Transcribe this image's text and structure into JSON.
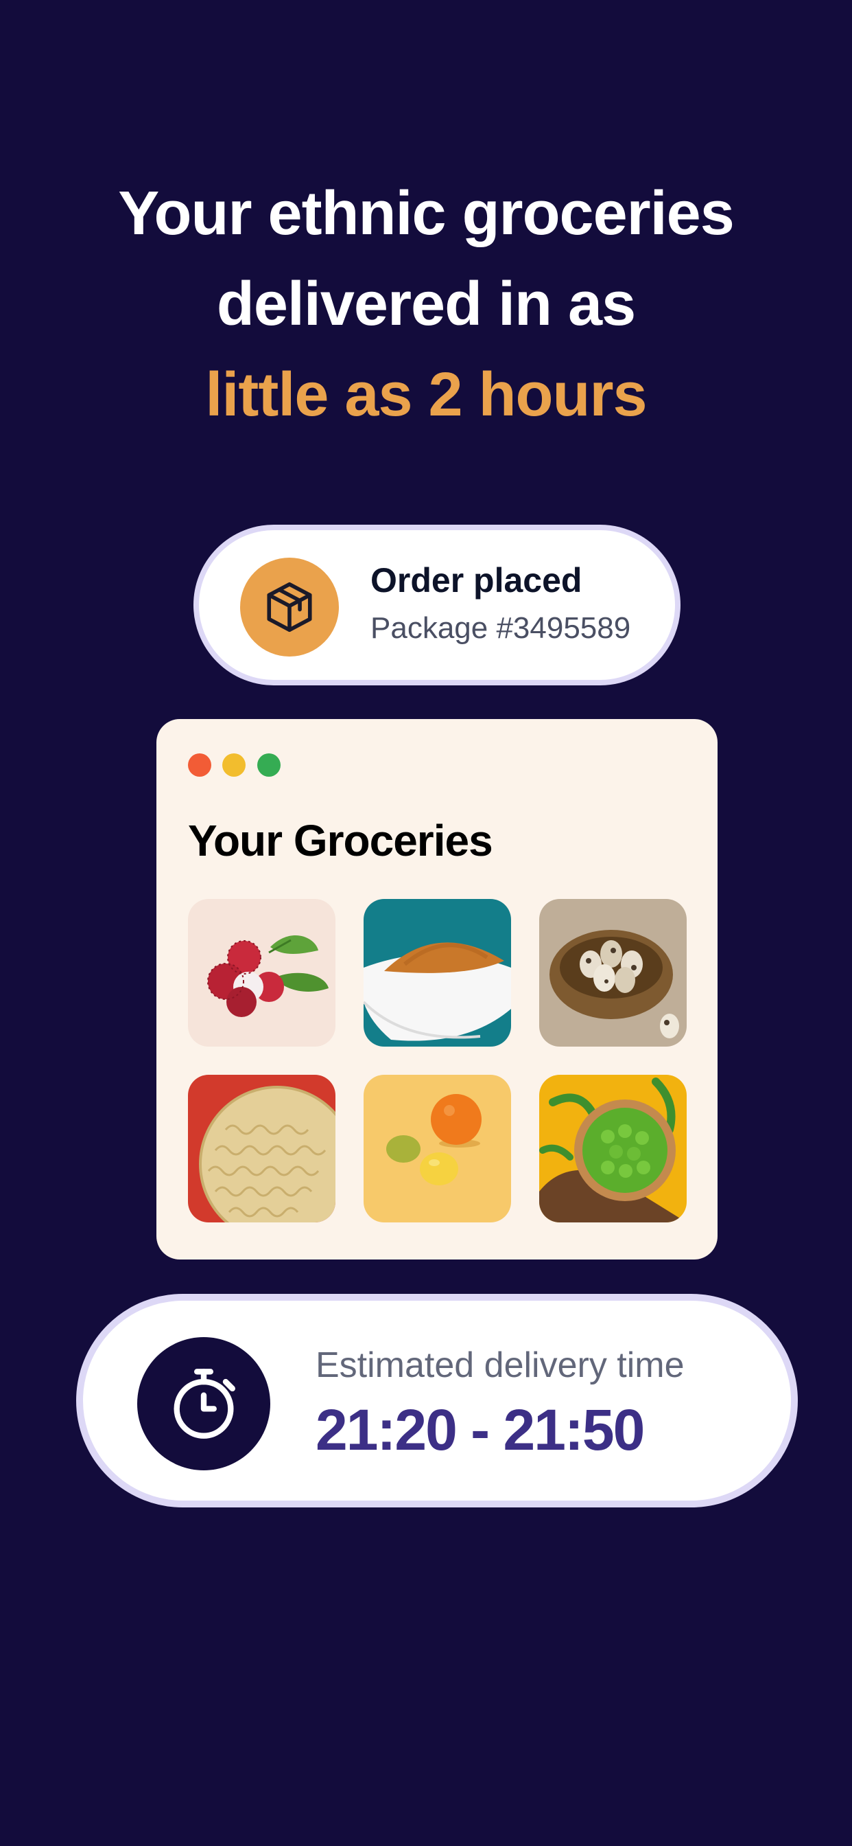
{
  "headline": {
    "line1": "Your ethnic groceries",
    "line2": "delivered in as",
    "line3": "little as 2 hours"
  },
  "order": {
    "title": "Order placed",
    "subtitle": "Package #3495589",
    "icon": "package-box-icon"
  },
  "groceries": {
    "title": "Your Groceries",
    "window_dots": [
      "#f25c36",
      "#f2bd2e",
      "#35ac53"
    ],
    "items": [
      {
        "name": "lychee"
      },
      {
        "name": "ground-spice"
      },
      {
        "name": "quail-eggs"
      },
      {
        "name": "instant-noodles"
      },
      {
        "name": "citrus-fruits"
      },
      {
        "name": "green-peas"
      }
    ]
  },
  "delivery": {
    "label": "Estimated delivery time",
    "time": "21:20 - 21:50",
    "icon": "stopwatch-icon"
  },
  "colors": {
    "background": "#130c3c",
    "accent": "#eaa24c",
    "time_text": "#3c2f86",
    "pill_border": "#ddd8f6",
    "card_background": "#fcf3ea"
  }
}
